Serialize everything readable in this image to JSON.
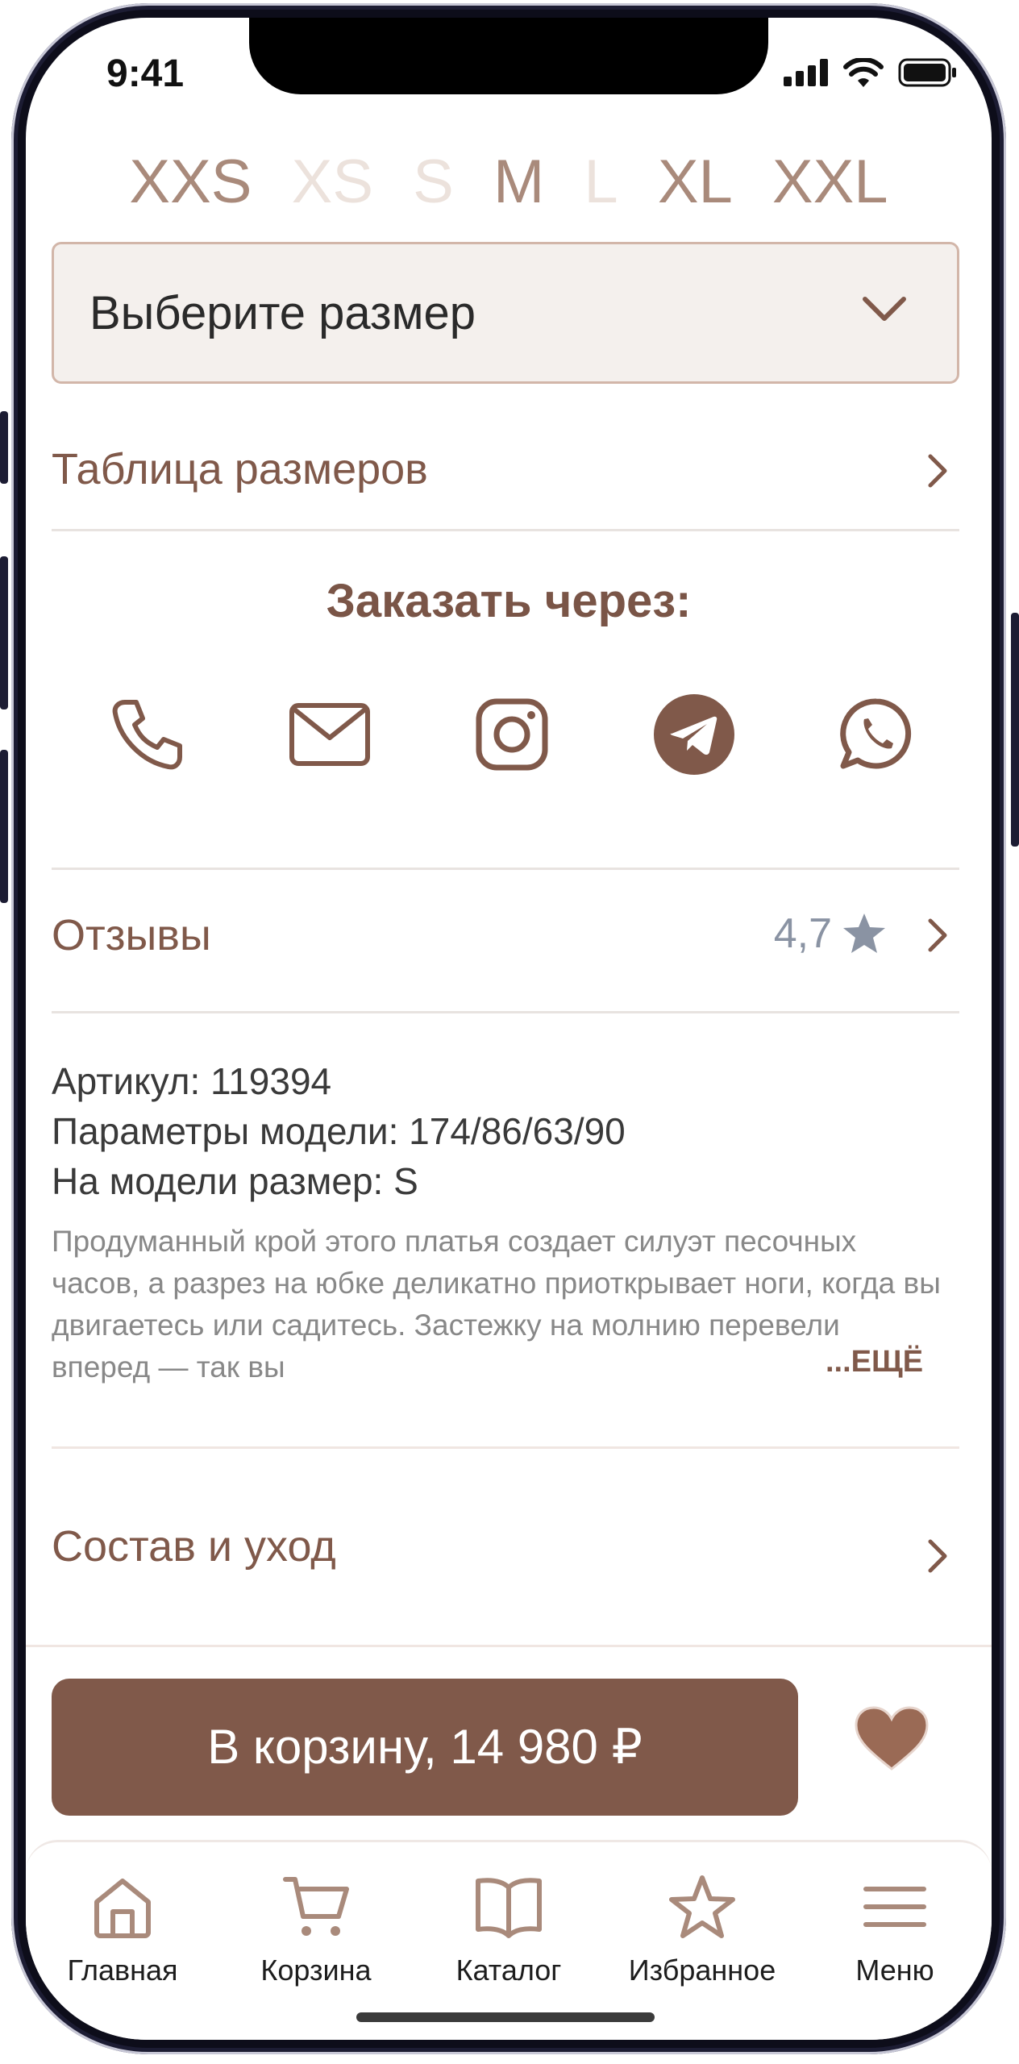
{
  "status_bar": {
    "time": "9:41"
  },
  "sizes": [
    {
      "label": "XXS",
      "available": true
    },
    {
      "label": "XS",
      "available": false
    },
    {
      "label": "S",
      "available": false
    },
    {
      "label": "M",
      "available": true
    },
    {
      "label": "L",
      "available": false
    },
    {
      "label": "XL",
      "available": true
    },
    {
      "label": "XXL",
      "available": true
    }
  ],
  "size_select": {
    "placeholder": "Выберите размер"
  },
  "size_table": {
    "label": "Таблица размеров"
  },
  "order_via": {
    "title": "Заказать через:",
    "channels": [
      "phone-icon",
      "mail-icon",
      "instagram-icon",
      "telegram-icon",
      "whatsapp-icon"
    ]
  },
  "reviews": {
    "label": "Отзывы",
    "rating": "4,7"
  },
  "product": {
    "article": "Артикул: 119394",
    "model_params": "Параметры модели: 174/86/63/90",
    "model_size": "На модели размер: S",
    "description": "Продуманный крой этого платья создает силуэт песочных часов, а разрез на юбке деликатно приоткрывает ноги, когда вы двигаетесь или садитесь. Застежку на молнию перевели вперед — так вы",
    "more_label": "...ЕЩЁ"
  },
  "composition": {
    "label": "Состав и уход"
  },
  "cart_button": {
    "label": "В корзину, 14 980 ₽"
  },
  "tabbar": {
    "items": [
      {
        "label": "Главная",
        "icon": "home-icon"
      },
      {
        "label": "Корзина",
        "icon": "cart-icon"
      },
      {
        "label": "Каталог",
        "icon": "book-icon"
      },
      {
        "label": "Избранное",
        "icon": "star-icon"
      },
      {
        "label": "Меню",
        "icon": "menu-icon"
      }
    ]
  },
  "colors": {
    "accent": "#80594a",
    "accent_light": "#a98a7b",
    "unavailable": "#ece2dc"
  }
}
